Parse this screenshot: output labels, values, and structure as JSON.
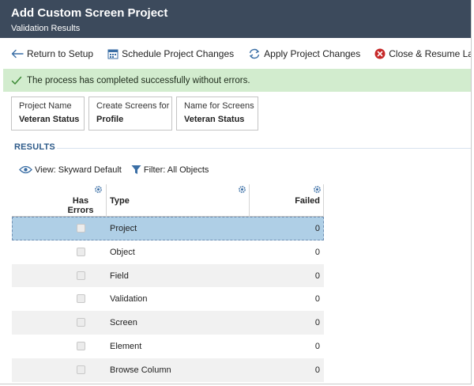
{
  "header": {
    "title": "Add Custom Screen Project",
    "subtitle": "Validation Results"
  },
  "toolbar": {
    "return_label": "Return to Setup",
    "schedule_label": "Schedule Project Changes",
    "apply_label": "Apply Project Changes",
    "close_label": "Close & Resume Later"
  },
  "message": {
    "text": "The process has completed successfully without errors."
  },
  "cards": [
    {
      "label": "Project Name",
      "value": "Veteran Status"
    },
    {
      "label": "Create Screens for",
      "value": "Profile"
    },
    {
      "label": "Name for Screens",
      "value": "Veteran Status"
    }
  ],
  "results": {
    "heading": "RESULTS",
    "view_label": "View: Skyward Default",
    "filter_label": "Filter: All Objects",
    "columns": {
      "has_errors": "Has Errors",
      "type": "Type",
      "failed": "Failed"
    },
    "rows": [
      {
        "type": "Project",
        "failed": "0",
        "selected": true
      },
      {
        "type": "Object",
        "failed": "0"
      },
      {
        "type": "Field",
        "failed": "0"
      },
      {
        "type": "Validation",
        "failed": "0"
      },
      {
        "type": "Screen",
        "failed": "0"
      },
      {
        "type": "Element",
        "failed": "0"
      },
      {
        "type": "Browse Column",
        "failed": "0"
      }
    ]
  },
  "colors": {
    "header_bg": "#3c4a5c",
    "success_bg": "#d2ecce",
    "accent": "#2e5b8a",
    "selected_row": "#afcfe6",
    "close_icon": "#c62828"
  },
  "icons": {
    "return": "arrow-left-icon",
    "schedule": "calendar-icon",
    "apply": "refresh-icon",
    "close": "close-circle-icon",
    "success": "checkmark-icon",
    "view": "eye-icon",
    "filter": "funnel-icon",
    "column_settings": "gear-icon"
  }
}
